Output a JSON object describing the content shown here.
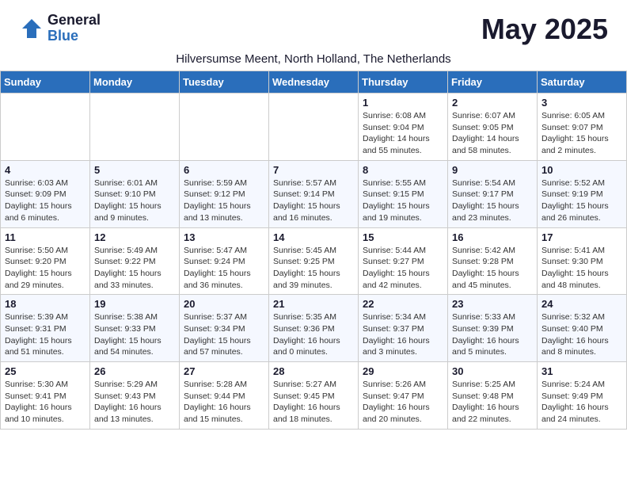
{
  "logo": {
    "general": "General",
    "blue": "Blue"
  },
  "title": "May 2025",
  "subtitle": "Hilversumse Meent, North Holland, The Netherlands",
  "weekdays": [
    "Sunday",
    "Monday",
    "Tuesday",
    "Wednesday",
    "Thursday",
    "Friday",
    "Saturday"
  ],
  "weeks": [
    [
      {
        "day": "",
        "info": ""
      },
      {
        "day": "",
        "info": ""
      },
      {
        "day": "",
        "info": ""
      },
      {
        "day": "",
        "info": ""
      },
      {
        "day": "1",
        "info": "Sunrise: 6:08 AM\nSunset: 9:04 PM\nDaylight: 14 hours\nand 55 minutes."
      },
      {
        "day": "2",
        "info": "Sunrise: 6:07 AM\nSunset: 9:05 PM\nDaylight: 14 hours\nand 58 minutes."
      },
      {
        "day": "3",
        "info": "Sunrise: 6:05 AM\nSunset: 9:07 PM\nDaylight: 15 hours\nand 2 minutes."
      }
    ],
    [
      {
        "day": "4",
        "info": "Sunrise: 6:03 AM\nSunset: 9:09 PM\nDaylight: 15 hours\nand 6 minutes."
      },
      {
        "day": "5",
        "info": "Sunrise: 6:01 AM\nSunset: 9:10 PM\nDaylight: 15 hours\nand 9 minutes."
      },
      {
        "day": "6",
        "info": "Sunrise: 5:59 AM\nSunset: 9:12 PM\nDaylight: 15 hours\nand 13 minutes."
      },
      {
        "day": "7",
        "info": "Sunrise: 5:57 AM\nSunset: 9:14 PM\nDaylight: 15 hours\nand 16 minutes."
      },
      {
        "day": "8",
        "info": "Sunrise: 5:55 AM\nSunset: 9:15 PM\nDaylight: 15 hours\nand 19 minutes."
      },
      {
        "day": "9",
        "info": "Sunrise: 5:54 AM\nSunset: 9:17 PM\nDaylight: 15 hours\nand 23 minutes."
      },
      {
        "day": "10",
        "info": "Sunrise: 5:52 AM\nSunset: 9:19 PM\nDaylight: 15 hours\nand 26 minutes."
      }
    ],
    [
      {
        "day": "11",
        "info": "Sunrise: 5:50 AM\nSunset: 9:20 PM\nDaylight: 15 hours\nand 29 minutes."
      },
      {
        "day": "12",
        "info": "Sunrise: 5:49 AM\nSunset: 9:22 PM\nDaylight: 15 hours\nand 33 minutes."
      },
      {
        "day": "13",
        "info": "Sunrise: 5:47 AM\nSunset: 9:24 PM\nDaylight: 15 hours\nand 36 minutes."
      },
      {
        "day": "14",
        "info": "Sunrise: 5:45 AM\nSunset: 9:25 PM\nDaylight: 15 hours\nand 39 minutes."
      },
      {
        "day": "15",
        "info": "Sunrise: 5:44 AM\nSunset: 9:27 PM\nDaylight: 15 hours\nand 42 minutes."
      },
      {
        "day": "16",
        "info": "Sunrise: 5:42 AM\nSunset: 9:28 PM\nDaylight: 15 hours\nand 45 minutes."
      },
      {
        "day": "17",
        "info": "Sunrise: 5:41 AM\nSunset: 9:30 PM\nDaylight: 15 hours\nand 48 minutes."
      }
    ],
    [
      {
        "day": "18",
        "info": "Sunrise: 5:39 AM\nSunset: 9:31 PM\nDaylight: 15 hours\nand 51 minutes."
      },
      {
        "day": "19",
        "info": "Sunrise: 5:38 AM\nSunset: 9:33 PM\nDaylight: 15 hours\nand 54 minutes."
      },
      {
        "day": "20",
        "info": "Sunrise: 5:37 AM\nSunset: 9:34 PM\nDaylight: 15 hours\nand 57 minutes."
      },
      {
        "day": "21",
        "info": "Sunrise: 5:35 AM\nSunset: 9:36 PM\nDaylight: 16 hours\nand 0 minutes."
      },
      {
        "day": "22",
        "info": "Sunrise: 5:34 AM\nSunset: 9:37 PM\nDaylight: 16 hours\nand 3 minutes."
      },
      {
        "day": "23",
        "info": "Sunrise: 5:33 AM\nSunset: 9:39 PM\nDaylight: 16 hours\nand 5 minutes."
      },
      {
        "day": "24",
        "info": "Sunrise: 5:32 AM\nSunset: 9:40 PM\nDaylight: 16 hours\nand 8 minutes."
      }
    ],
    [
      {
        "day": "25",
        "info": "Sunrise: 5:30 AM\nSunset: 9:41 PM\nDaylight: 16 hours\nand 10 minutes."
      },
      {
        "day": "26",
        "info": "Sunrise: 5:29 AM\nSunset: 9:43 PM\nDaylight: 16 hours\nand 13 minutes."
      },
      {
        "day": "27",
        "info": "Sunrise: 5:28 AM\nSunset: 9:44 PM\nDaylight: 16 hours\nand 15 minutes."
      },
      {
        "day": "28",
        "info": "Sunrise: 5:27 AM\nSunset: 9:45 PM\nDaylight: 16 hours\nand 18 minutes."
      },
      {
        "day": "29",
        "info": "Sunrise: 5:26 AM\nSunset: 9:47 PM\nDaylight: 16 hours\nand 20 minutes."
      },
      {
        "day": "30",
        "info": "Sunrise: 5:25 AM\nSunset: 9:48 PM\nDaylight: 16 hours\nand 22 minutes."
      },
      {
        "day": "31",
        "info": "Sunrise: 5:24 AM\nSunset: 9:49 PM\nDaylight: 16 hours\nand 24 minutes."
      }
    ]
  ]
}
